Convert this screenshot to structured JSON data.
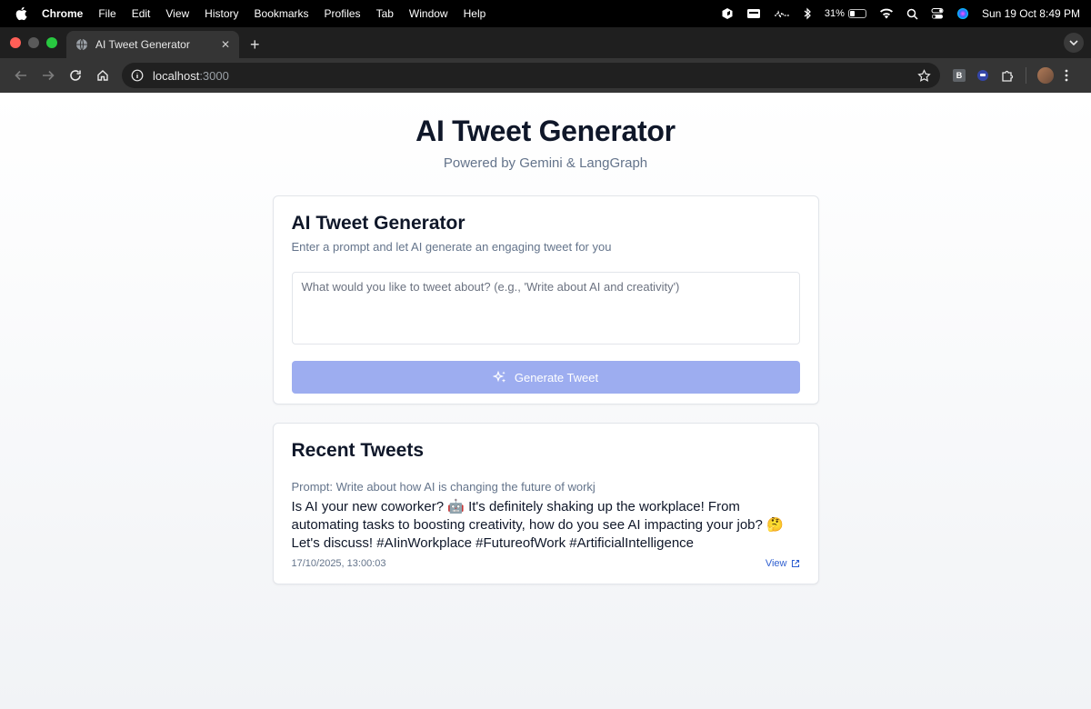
{
  "menubar": {
    "items": [
      "Chrome",
      "File",
      "Edit",
      "View",
      "History",
      "Bookmarks",
      "Profiles",
      "Tab",
      "Window",
      "Help"
    ],
    "battery": "31%",
    "datetime": "Sun 19 Oct  8:49 PM"
  },
  "browser": {
    "tab_title": "AI Tweet Generator",
    "url_host": "localhost",
    "url_port": ":3000",
    "ext_b_label": "B"
  },
  "page": {
    "title": "AI Tweet Generator",
    "subtitle": "Powered by Gemini & LangGraph"
  },
  "generator": {
    "title": "AI Tweet Generator",
    "description": "Enter a prompt and let AI generate an engaging tweet for you",
    "prompt_placeholder": "What would you like to tweet about? (e.g., 'Write about AI and creativity')",
    "prompt_value": "",
    "button_label": "Generate Tweet",
    "button_color": "#9dadf0"
  },
  "recent": {
    "title": "Recent Tweets",
    "tweets": [
      {
        "prompt": "Prompt: Write about how AI is changing the future of workj",
        "text": "Is AI your new coworker? 🤖 It's definitely shaking up the workplace! From automating tasks to boosting creativity, how do you see AI impacting your job? 🤔 Let's discuss! #AIinWorkplace #FutureofWork #ArtificialIntelligence",
        "date": "17/10/2025, 13:00:03",
        "view_label": "View"
      }
    ]
  }
}
